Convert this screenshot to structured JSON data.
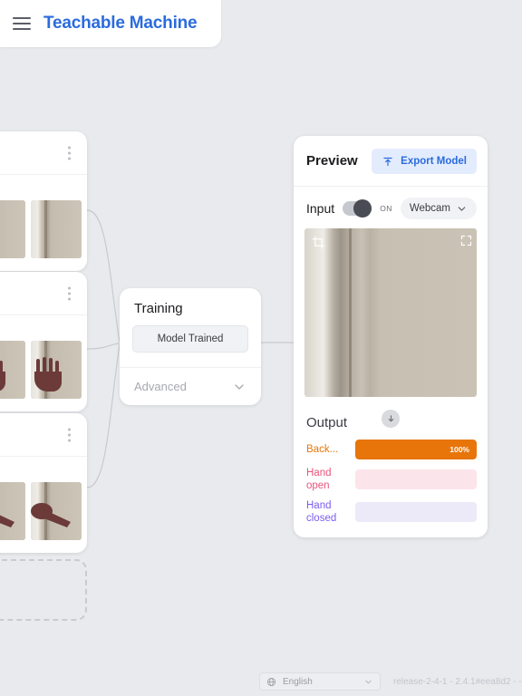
{
  "header": {
    "menu_icon": "hamburger-icon",
    "brand": "Teachable Machine"
  },
  "classes": [
    {
      "name_hidden": "",
      "menu_icon": "more-vertical-icon",
      "sample_kind": "background"
    },
    {
      "name_hidden": "",
      "menu_icon": "more-vertical-icon",
      "sample_kind": "hand-open"
    },
    {
      "name_hidden": "",
      "menu_icon": "more-vertical-icon",
      "sample_kind": "hand-closed"
    }
  ],
  "add_class": {
    "label": ""
  },
  "training": {
    "title": "Training",
    "button_label": "Model Trained",
    "advanced_label": "Advanced",
    "advanced_icon": "chevron-down-icon"
  },
  "preview": {
    "title": "Preview",
    "export_label": "Export Model",
    "export_icon": "upload-icon",
    "input_label": "Input",
    "toggle_state": "ON",
    "source_value": "Webcam",
    "source_icon": "chevron-down-icon",
    "crop_icon": "crop-icon",
    "fullscreen_icon": "fullscreen-icon",
    "download_icon": "download-arrow-icon",
    "output_title": "Output",
    "rows": [
      {
        "label": "Back...",
        "percent_label": "100%",
        "percent": 100,
        "color": "#e8750a",
        "track": "#f6ead9",
        "show_pct": true
      },
      {
        "label": "Hand open",
        "percent_label": "",
        "percent": 0,
        "color": "#e8547c",
        "track": "#fbe5ea",
        "show_pct": false
      },
      {
        "label": "Hand closed",
        "percent_label": "",
        "percent": 0,
        "color": "#7b5cf0",
        "track": "#eceaf9",
        "show_pct": false
      }
    ]
  },
  "footer": {
    "language_icon": "globe-icon",
    "language_value": "English",
    "language_chevron": "chevron-down-icon",
    "version": "release-2-4-1 - 2.4.1#eea8d2 - -"
  }
}
